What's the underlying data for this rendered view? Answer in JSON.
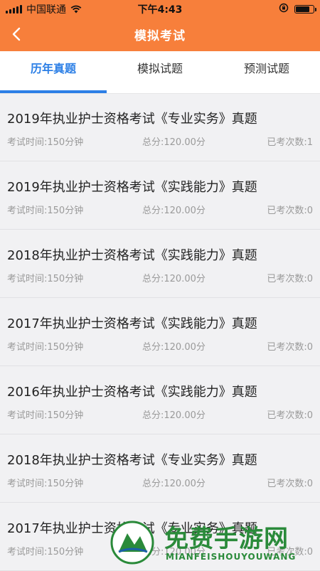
{
  "status_bar": {
    "carrier": "中国联通",
    "time": "下午4:43",
    "battery_level": 0.8,
    "icons": [
      "signal-icon",
      "wifi-icon",
      "rotation-lock-icon",
      "battery-icon"
    ]
  },
  "navbar": {
    "title": "模拟考试",
    "back_icon": "chevron-left-icon"
  },
  "tabs": [
    {
      "label": "历年真题",
      "active": true
    },
    {
      "label": "模拟试题",
      "active": false
    },
    {
      "label": "预测试题",
      "active": false
    }
  ],
  "exams": [
    {
      "title": "2019年执业护士资格考试《专业实务》真题",
      "duration": "考试时间:150分钟",
      "score": "总分:120.00分",
      "attempts": "已考次数:1"
    },
    {
      "title": "2019年执业护士资格考试《实践能力》真题",
      "duration": "考试时间:150分钟",
      "score": "总分:120.00分",
      "attempts": "已考次数:0"
    },
    {
      "title": "2018年执业护士资格考试《实践能力》真题",
      "duration": "考试时间:150分钟",
      "score": "总分:120.00分",
      "attempts": "已考次数:0"
    },
    {
      "title": "2017年执业护士资格考试《实践能力》真题",
      "duration": "考试时间:150分钟",
      "score": "总分:120.00分",
      "attempts": "已考次数:0"
    },
    {
      "title": "2016年执业护士资格考试《实践能力》真题",
      "duration": "考试时间:150分钟",
      "score": "总分:120.00分",
      "attempts": "已考次数:0"
    },
    {
      "title": "2018年执业护士资格考试《专业实务》真题",
      "duration": "考试时间:150分钟",
      "score": "总分:120.00分",
      "attempts": "已考次数:0"
    },
    {
      "title": "2017年执业护士资格考试《专业实务》真题",
      "duration": "考试时间:150分钟",
      "score": "总分:120.00分",
      "attempts": "已考次数:0"
    }
  ],
  "watermark": {
    "title": "免费手游网",
    "subtitle": "MIANFEISHOUYOUWANG"
  },
  "colors": {
    "brand_orange": "#f77f3b",
    "active_blue": "#2c7fe6",
    "watermark_green": "#2a8a3a"
  }
}
